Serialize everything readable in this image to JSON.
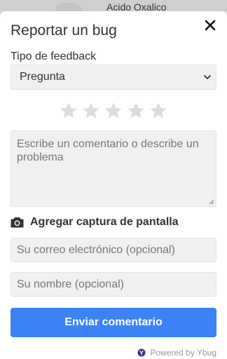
{
  "background": {
    "partial_text": "Acido Oxalico"
  },
  "modal": {
    "title": "Reportar un bug",
    "feedback_type_label": "Tipo de feedback",
    "feedback_type_value": "Pregunta",
    "rating": {
      "max": 5,
      "value": 0
    },
    "comment_placeholder": "Escribe un comentario o describe un problema",
    "screenshot_label": "Agregar captura de pantalla",
    "email_placeholder": "Su correo electrónico (opcional)",
    "name_placeholder": "Su nombre (opcional)",
    "submit_label": "Enviar comentario",
    "powered_by": "Powered by Ybug"
  },
  "colors": {
    "primary_button": "#3b82f6",
    "star_empty": "#dcdcdc",
    "ybug_logo": "#3b2f8f"
  }
}
